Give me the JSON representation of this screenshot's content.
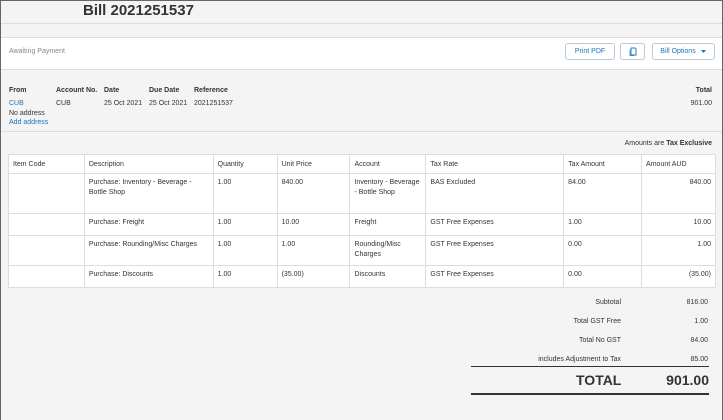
{
  "header": {
    "title": "Bill 2021251537"
  },
  "status": {
    "label": "Awaiting Payment"
  },
  "toolbar": {
    "print_pdf": "Print PDF",
    "bill_options": "Bill Options"
  },
  "info": {
    "from_label": "From",
    "from_value": "CUB",
    "no_address": "No address",
    "add_address": "Add address",
    "account_label": "Account No.",
    "account_value": "CUB",
    "date_label": "Date",
    "date_value": "25 Oct 2021",
    "due_label": "Due Date",
    "due_value": "25 Oct 2021",
    "ref_label": "Reference",
    "ref_value": "2021251537",
    "total_label": "Total",
    "total_value": "901.00"
  },
  "tax_note": {
    "prefix": "Amounts are",
    "mode": "Tax Exclusive"
  },
  "table": {
    "headers": [
      "Item Code",
      "Description",
      "Quantity",
      "Unit Price",
      "Account",
      "Tax Rate",
      "Tax Amount",
      "Amount AUD"
    ],
    "rows": [
      {
        "code": "",
        "desc": "Purchase: Inventory - Beverage - Bottle Shop",
        "qty": "1.00",
        "price": "840.00",
        "account": "Inventory - Beverage - Bottle Shop",
        "rate": "BAS Excluded",
        "tax": "84.00",
        "amount": "840.00"
      },
      {
        "code": "",
        "desc": "Purchase: Freight",
        "qty": "1.00",
        "price": "10.00",
        "account": "Freight",
        "rate": "GST Free Expenses",
        "tax": "1.00",
        "amount": "10.00"
      },
      {
        "code": "",
        "desc": "Purchase: Rounding/Misc Charges",
        "qty": "1.00",
        "price": "1.00",
        "account": "Rounding/Misc Charges",
        "rate": "GST Free Expenses",
        "tax": "0.00",
        "amount": "1.00"
      },
      {
        "code": "",
        "desc": "Purchase: Discounts",
        "qty": "1.00",
        "price": "(35.00)",
        "account": "Discounts",
        "rate": "GST Free Expenses",
        "tax": "0.00",
        "amount": "(35.00)"
      }
    ]
  },
  "totals": {
    "subtotal_label": "Subtotal",
    "subtotal_value": "816.00",
    "gst_free_label": "Total GST Free",
    "gst_free_value": "1.00",
    "no_gst_label": "Total No GST",
    "no_gst_value": "84.00",
    "adjust_label": "includes Adjustment to Tax",
    "adjust_value": "85.00",
    "grand_label": "TOTAL",
    "grand_value": "901.00"
  }
}
